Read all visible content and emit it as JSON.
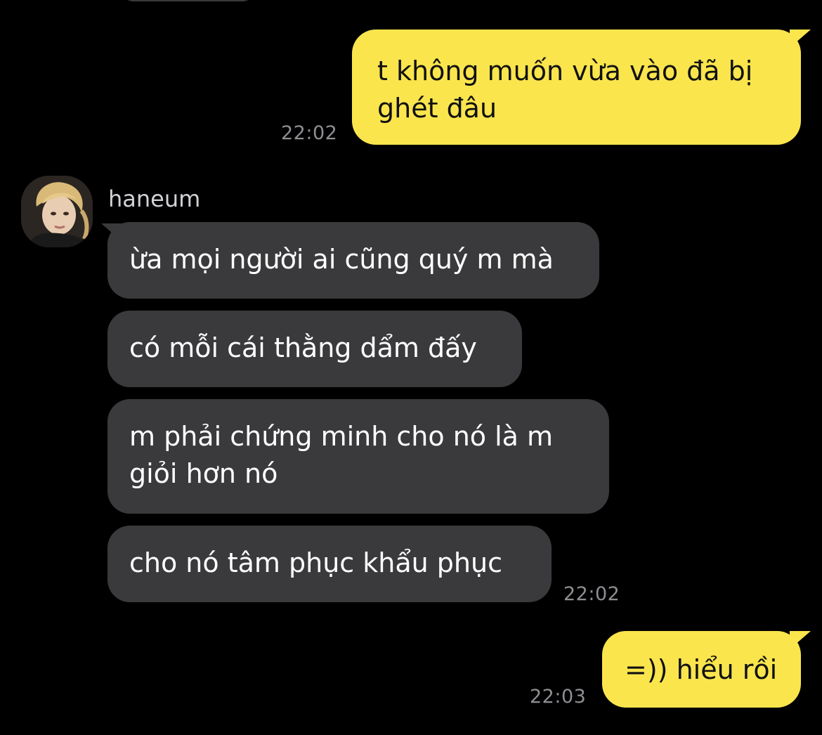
{
  "colors": {
    "background": "#000000",
    "outgoing_bubble": "#fae54d",
    "outgoing_text": "#111111",
    "incoming_bubble": "#3a3a3c",
    "incoming_text": "#ffffff",
    "timestamp": "#8e8e93"
  },
  "conversation": {
    "sender": {
      "name": "haneum",
      "avatar_icon": "profile-photo"
    },
    "messages": [
      {
        "direction": "outgoing",
        "text": "t không muốn vừa vào đã bị\nghét đâu",
        "time": "22:02"
      },
      {
        "direction": "incoming",
        "text": "ừa mọi người ai cũng quý m mà"
      },
      {
        "direction": "incoming",
        "text": "có mỗi cái thằng dẩm đấy"
      },
      {
        "direction": "incoming",
        "text": "m phải chứng minh cho nó là m\ngiỏi hơn nó"
      },
      {
        "direction": "incoming",
        "text": "cho nó tâm phục khẩu phục",
        "time": "22:02"
      },
      {
        "direction": "outgoing",
        "text": "=)) hiểu rồi",
        "time": "22:03"
      }
    ]
  }
}
